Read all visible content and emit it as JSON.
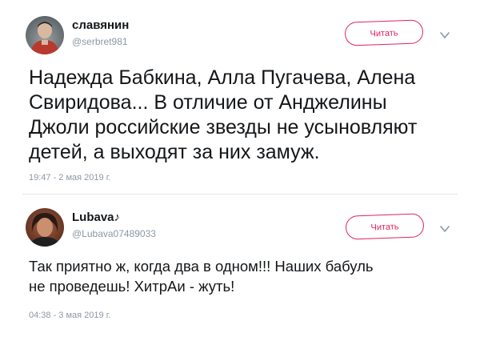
{
  "tweets": [
    {
      "name": "славянин",
      "handle": "@serbret981",
      "follow_label": "Читать",
      "text": "Надежда Бабкина, Алла Пугачева, Алена\nСвиридова... В отличие от Анджелины\nДжоли российские звезды не усыновляют\nдетей, а выходят за них замуж.",
      "timestamp": "19:47 - 2 мая 2019 г."
    },
    {
      "name": "Lubava♪",
      "handle": "@Lubava07489033",
      "follow_label": "Читать",
      "text": "Так приятно ж, когда два в одном!!! Наших бабуль\nне проведешь! ХитрАи - жуть!",
      "timestamp": "04:38 - 3 мая 2019 г."
    }
  ],
  "colors": {
    "accent": "#e0245e",
    "muted": "#8b98a5",
    "text": "#14171a"
  },
  "icons": {
    "menu": "chevron-down-icon"
  }
}
